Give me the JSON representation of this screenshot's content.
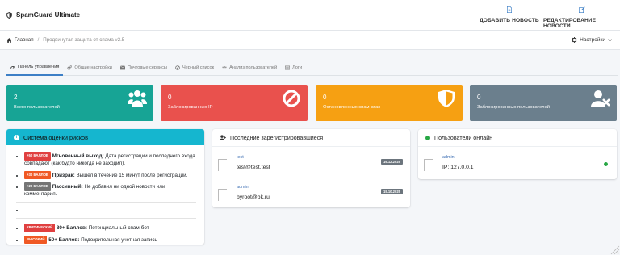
{
  "app": {
    "title": "SpamGuard Ultimate"
  },
  "top_actions": {
    "add_news": "ДОБАВИТЬ НОВОСТЬ",
    "edit_news": "РЕДАКТИРОВАНИЕ НОВОСТИ"
  },
  "breadcrumb": {
    "home": "Главная",
    "separator": "/",
    "current": "Продвинутая защита от спама v2.5"
  },
  "settings_label": "Настройки",
  "tabs": [
    {
      "label": "Панель управления",
      "icon": "dashboard-icon",
      "active": true
    },
    {
      "label": "Общие настройки",
      "icon": "gears-icon",
      "active": false
    },
    {
      "label": "Почтовые сервисы",
      "icon": "envelope-icon",
      "active": false
    },
    {
      "label": "Черный список",
      "icon": "ban-icon",
      "active": false
    },
    {
      "label": "Анализ пользователей",
      "icon": "users-icon",
      "active": false
    },
    {
      "label": "Логи",
      "icon": "list-icon",
      "active": false
    }
  ],
  "stats": [
    {
      "value": "2",
      "label": "Всего пользователей",
      "icon": "users-icon",
      "color": "#17a495"
    },
    {
      "value": "0",
      "label": "Заблокированных IP",
      "icon": "ban-icon",
      "color": "#e9514d"
    },
    {
      "value": "0",
      "label": "Остановленных спам-атак",
      "icon": "shield-icon",
      "color": "#f6a012"
    },
    {
      "value": "0",
      "label": "Заблокированных пользователей",
      "icon": "user-block-icon",
      "color": "#6b7f8d"
    }
  ],
  "risk": {
    "title": "Система оценки рисков",
    "items": [
      {
        "badge": "+50 БАЛЛОВ",
        "name": "Мгновенный выход:",
        "text": " Дата регистрации и последнего входа совпадают (как будто никогда не заходил)."
      },
      {
        "badge": "+30 БАЛЛОВ",
        "name": "Призрак:",
        "text": " Вышел в течение 15 минут после регистрации."
      },
      {
        "badge": "+20 БАЛЛОВ",
        "name": "Пассивный:",
        "text": " Не добавил ни одной новости или комментария."
      }
    ],
    "levels": [
      {
        "badge": "КРИТИЧЕСКИЙ",
        "name": "80+ Баллов:",
        "text": " Потенциальный спам-бот"
      },
      {
        "badge": "ВЫСОКИЙ",
        "name": "50+ Баллов:",
        "text": " Подозрительная учетная запись"
      }
    ]
  },
  "recent": {
    "title": "Последние зарегистрировавшиеся",
    "users": [
      {
        "name": "test",
        "email": "test@test.test",
        "date": "16.12.2025"
      },
      {
        "name": "admin",
        "email": "byroot@bk.ru",
        "date": "15.10.2025"
      }
    ]
  },
  "online": {
    "title": "Пользователи онлайн",
    "users": [
      {
        "name": "admin",
        "ip": "IP: 127.0.0.1"
      }
    ]
  }
}
